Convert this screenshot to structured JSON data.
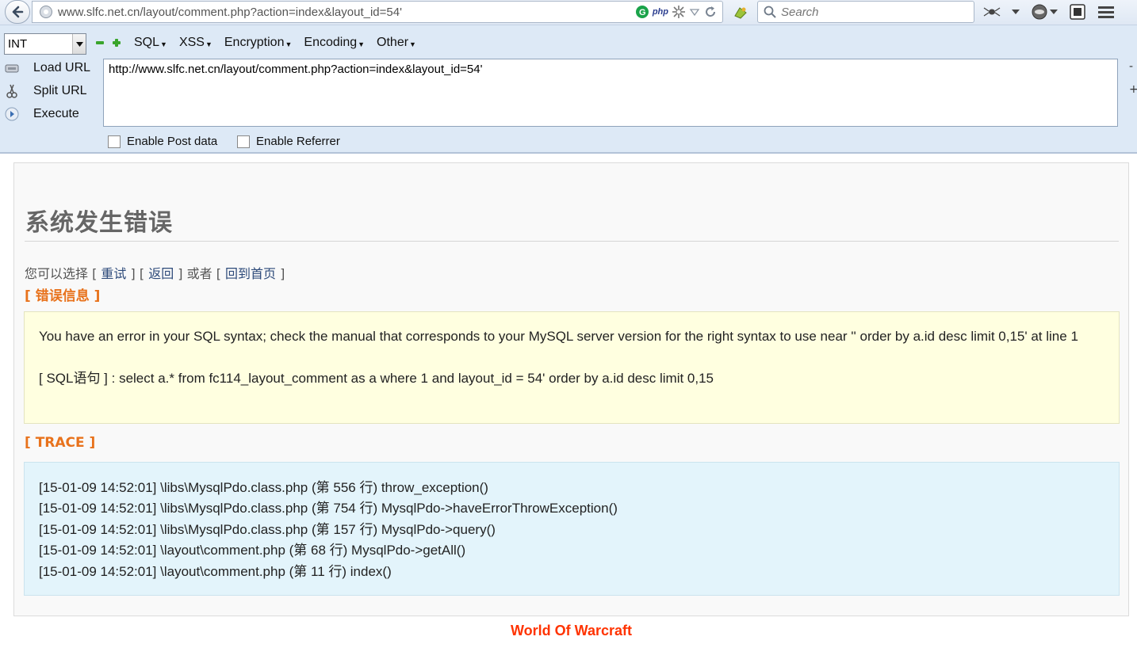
{
  "browser": {
    "url": "www.slfc.net.cn/layout/comment.php?action=index&layout_id=54'",
    "search_placeholder": "Search",
    "php_badge": "php"
  },
  "hackbar": {
    "type_select": "INT",
    "menus": [
      "SQL",
      "XSS",
      "Encryption",
      "Encoding",
      "Other"
    ],
    "load_url": "Load URL",
    "split_url": "Split URL",
    "execute": "Execute",
    "url_value": "http://www.slfc.net.cn/layout/comment.php?action=index&layout_id=54'",
    "enable_post": "Enable Post data",
    "enable_referrer": "Enable Referrer",
    "minus": "-",
    "plus": "+"
  },
  "page": {
    "title": "系统发生错误",
    "choose_prefix": "您可以选择 [ ",
    "retry": "重试",
    "sep1": " ] [ ",
    "back": "返回",
    "sep2": " ] 或者 [ ",
    "home": "回到首页",
    "choose_suffix": " ]",
    "error_heading": "[ 错误信息 ]",
    "error_message": "You have an error in your SQL syntax; check the manual that corresponds to your MySQL server version for the right syntax to use near '' order by a.id desc limit 0,15' at line 1",
    "sql_line": "[ SQL语句 ] : select a.* from fc114_layout_comment as a where 1 and layout_id = 54' order by a.id desc limit 0,15",
    "trace_heading": "[ TRACE ]",
    "trace": [
      "[15-01-09 14:52:01] \\libs\\MysqlPdo.class.php (第 556 行) throw_exception()",
      "[15-01-09 14:52:01] \\libs\\MysqlPdo.class.php (第 754 行) MysqlPdo->haveErrorThrowException()",
      "[15-01-09 14:52:01] \\libs\\MysqlPdo.class.php (第 157 行) MysqlPdo->query()",
      "[15-01-09 14:52:01] \\layout\\comment.php (第 68 行) MysqlPdo->getAll()",
      "[15-01-09 14:52:01] \\layout\\comment.php (第 11 行) index()"
    ],
    "footer": "World Of Warcraft"
  }
}
